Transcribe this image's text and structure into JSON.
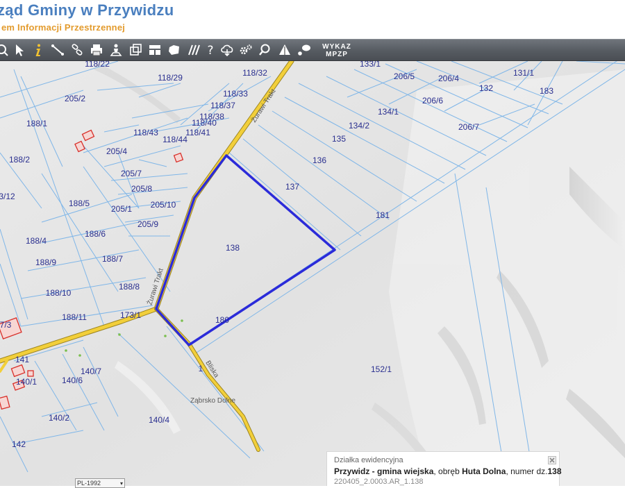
{
  "header": {
    "title": "ząd Gminy w Przywidzu",
    "subtitle": "em Informacji Przestrzennej"
  },
  "toolbar": {
    "icons": [
      "zoom-icon",
      "pointer-icon",
      "info-icon",
      "measure-line-icon",
      "link-icon",
      "print-icon",
      "identify-icon",
      "export-icon",
      "layout-icon",
      "shape-icon",
      "hatch-icon",
      "help-icon",
      "cloud-download-icon",
      "settings-icon",
      "search-icon",
      "scale-icon",
      "comment-icon"
    ],
    "wykaz_line1": "WYKAZ",
    "wykaz_line2": "MPZP"
  },
  "colors": {
    "toolbar": "#565b61",
    "parcel_line": "#7fb6e8",
    "parcel_label": "#2a2f8f",
    "selected_parcel": "#2b2bd9",
    "road": "#f2cf3a",
    "building": "#d9302a"
  },
  "map": {
    "parcel_labels": [
      "118/22",
      "118/29",
      "118/32",
      "133/1",
      "206/5",
      "206/4",
      "131/1",
      "183",
      "132",
      "205/2",
      "118/33",
      "118/37",
      "118/38",
      "118/40",
      "118/41",
      "134/1",
      "206/6",
      "206/7",
      "188/1",
      "118/43",
      "118/44",
      "134/2",
      "135",
      "205/4",
      "188/2",
      "136",
      "205/7",
      "205/8",
      "137",
      "3/12",
      "188/5",
      "205/1",
      "205/10",
      "181",
      "205/9",
      "188/6",
      "188/4",
      "138",
      "188/9",
      "188/7",
      "188/8",
      "188/10",
      "188/11",
      "173/1",
      "180",
      "7/3",
      "141",
      "140/7",
      "140/1",
      "140/6",
      "152/1",
      "140/2",
      "140/4",
      "142",
      "1"
    ],
    "road_labels": [
      "Żurawi Trakt",
      "Żurawi Trakt",
      "Bliska"
    ],
    "place_label": "Ząbrsko Dolne"
  },
  "info": {
    "header": "Działka ewidencyjna",
    "gmina": "Przywidz - gmina wiejska",
    "obreb_prefix": ", obręb ",
    "obreb": "Huta Dolna",
    "numer_prefix": ", numer dz.",
    "numer": "138",
    "identifier": "220405_2.0003.AR_1.138"
  },
  "crs": {
    "selected": "PL-1992"
  }
}
